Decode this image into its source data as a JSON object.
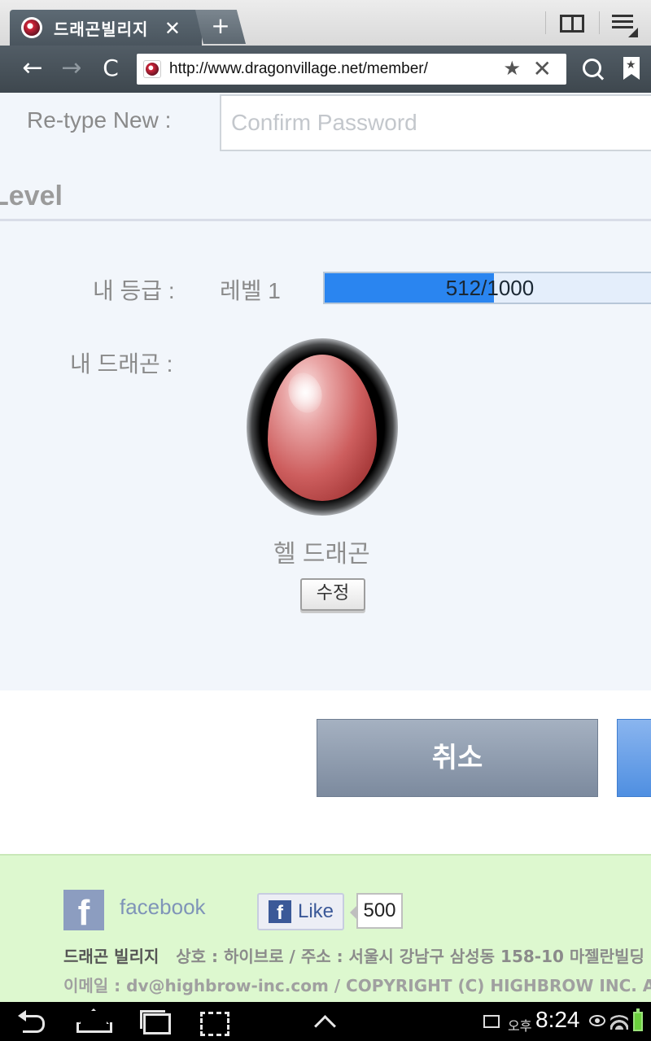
{
  "browser": {
    "tab_title": "드래곤빌리지",
    "tab_close": "✕",
    "new_tab": "+",
    "nav_back": "←",
    "nav_forward": "→",
    "nav_reload": "C",
    "url": "http://www.dragonvillage.net/member/",
    "url_star": "★",
    "url_clear": "✕"
  },
  "form": {
    "retype_label": "Re-type New :",
    "confirm_placeholder": "Confirm Password",
    "confirm_value": ""
  },
  "level_section": {
    "heading": "Level",
    "grade_label": "내 등급 :",
    "grade_value": "레벨 1",
    "exp_text": "512/1000",
    "exp_current": 512,
    "exp_max": 1000,
    "dragon_label": "내 드래곤 :",
    "dragon_name": "헬 드래곤",
    "edit_button": "수정"
  },
  "actions": {
    "cancel": "취소"
  },
  "footer": {
    "fb_logo": "f",
    "facebook": "facebook",
    "like_f": "f",
    "like_label": "Like",
    "like_count": "500",
    "brand": "드래곤 빌리지",
    "company_info": "상호 : 하이브로  /  주소 : 서울시 강남구 삼성동 158-10 마젤란빌딩",
    "contact_line": "이메일 : dv@highbrow-inc.com  /  COPYRIGHT (C) HIGHBROW INC. ALL RIGHTS RESERVED"
  },
  "status_bar": {
    "ampm": "오후",
    "time": "8:24"
  },
  "colors": {
    "progress_fill": "#2a85f0",
    "footer_bg": "#ddf8cf",
    "cancel_button": "#7c8a9e",
    "confirm_button": "#4f8fe1"
  }
}
